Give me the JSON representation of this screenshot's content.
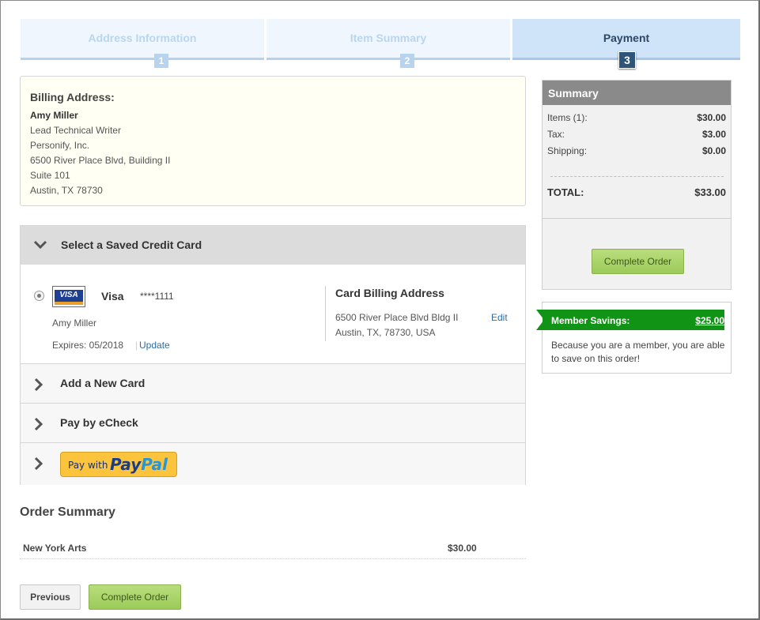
{
  "stepper": {
    "steps": [
      {
        "label": "Address Information",
        "number": "1"
      },
      {
        "label": "Item Summary",
        "number": "2"
      },
      {
        "label": "Payment",
        "number": "3"
      }
    ],
    "active_step": 3
  },
  "billing": {
    "heading": "Billing Address:",
    "name": "Amy Miller",
    "lines": [
      "Lead Technical Writer",
      "Personify, Inc.",
      "6500 River Place Blvd, Building II",
      "Suite 101",
      "Austin, TX 78730"
    ]
  },
  "payment": {
    "saved_card_header": "Select a Saved Credit Card",
    "card": {
      "logo_text": "VISA",
      "brand": "Visa",
      "number": "****1111",
      "holder": "Amy Miller",
      "expires": "Expires: 05/2018",
      "separator": "|",
      "update_label": "Update",
      "billing_title": "Card Billing Address",
      "billing_line1": "6500 River Place Blvd Bldg II",
      "billing_line2": "Austin, TX, 78730, USA",
      "edit_label": "Edit"
    },
    "add_card_label": "Add a New Card",
    "echeck_label": "Pay by eCheck",
    "paypal": {
      "prefix": "Pay with",
      "pay": "Pay",
      "pal": "Pal"
    }
  },
  "order_summary": {
    "title": "Order Summary",
    "items": [
      {
        "name": "New York Arts",
        "price": "$30.00"
      }
    ]
  },
  "buttons": {
    "previous": "Previous",
    "complete": "Complete Order"
  },
  "summary": {
    "title": "Summary",
    "items_label": "Items (1):",
    "items_value": "$30.00",
    "tax_label": "Tax:",
    "tax_value": "$3.00",
    "shipping_label": "Shipping:",
    "shipping_value": "$0.00",
    "total_label": "TOTAL:",
    "total_value": "$33.00"
  },
  "member_savings": {
    "label": "Member Savings:",
    "amount": "$25.00",
    "text": "Because you are a member, you are able to save on this order!"
  },
  "colors": {
    "accent_green": "#119415",
    "link_blue": "#2b6ca8",
    "active_step": "#2d5579"
  }
}
